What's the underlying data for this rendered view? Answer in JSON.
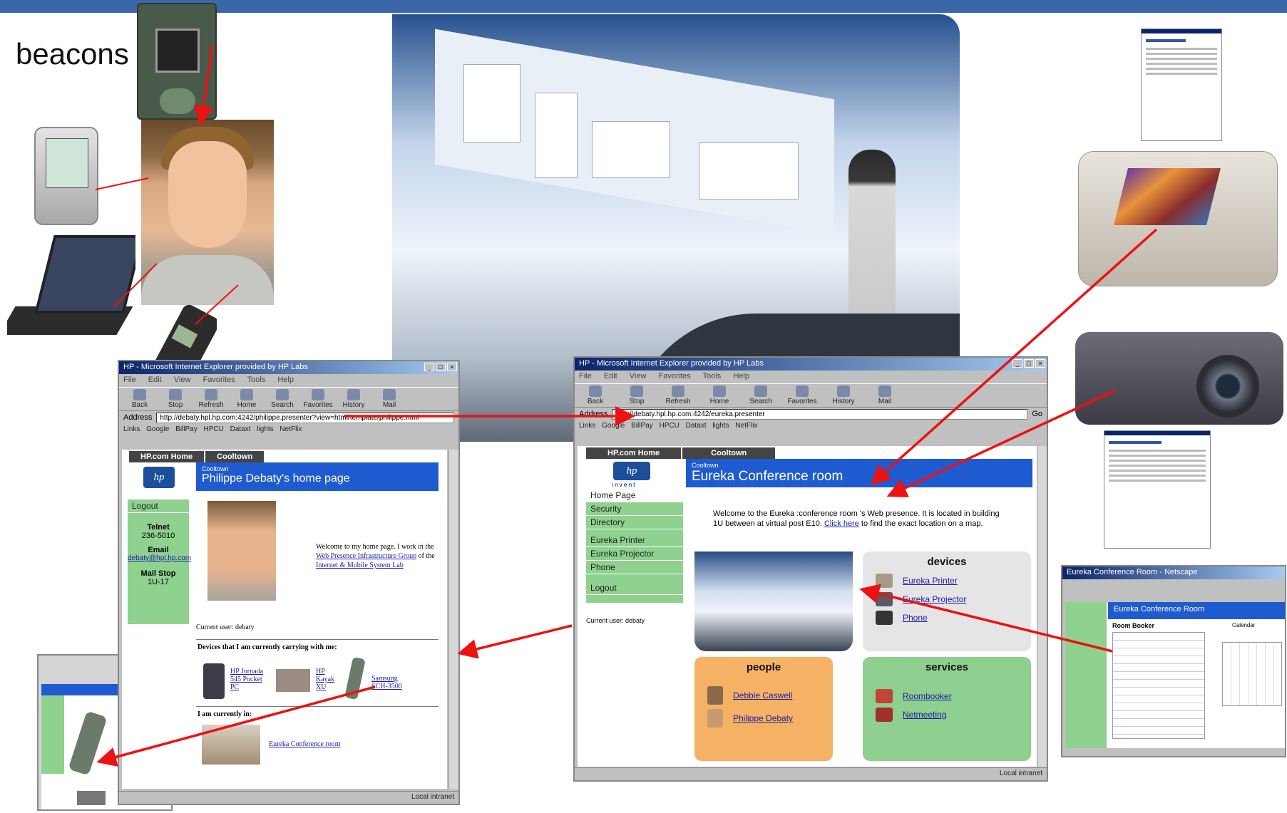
{
  "slide": {
    "caption": "beacons",
    "accent_color": "#3b67a8",
    "arrow_color": "#ee1111"
  },
  "left_window": {
    "title": "HP - Microsoft Internet Explorer provided by HP Labs",
    "menu": "File Edit View Favorites Tools Help",
    "toolbar": [
      "Back",
      "Stop",
      "Refresh",
      "Home",
      "Search",
      "Favorites",
      "History",
      "Mail"
    ],
    "address_label": "Address",
    "address": "http://debaty.hpl.hp.com:4242/philippe.presenter?view=html/template/philippe.html",
    "links": "Links  Google  BillPay  HPCU  Dataxt  lights  NetFlix",
    "tabs": [
      "HP.com Home",
      "Cooltown"
    ],
    "site_label": "Cooltown",
    "page_title": "Philippe Debaty's home page",
    "sidebar": {
      "logout": "Logout",
      "telnet_label": "Telnet",
      "telnet_value": "236-5010",
      "email_label": "Email",
      "email_value": "debaty@hpl.hp.com",
      "mailstop_label": "Mail Stop",
      "mailstop_value": "1U-17"
    },
    "welcome_prefix": "Welcome to my home page. I work in the",
    "welcome_link1": "Web Presence Infrastructure Group",
    "welcome_mid": "of the",
    "welcome_link2": "Internet & Mobile System Lab",
    "current_user": "Current user: debaty",
    "devices_heading": "Devices that I am currently carrying with me:",
    "devices": [
      "HP Jornada 545 Pocket PC",
      "HP Kayak XU",
      "Samsung SCH-3500"
    ],
    "i_am_heading": "I am currently in:",
    "location_link": "Eureka Conference room",
    "status": "Local intranet"
  },
  "right_window": {
    "title": "HP - Microsoft Internet Explorer provided by HP Labs",
    "menu": "File Edit View Favorites Tools Help",
    "toolbar": [
      "Back",
      "Stop",
      "Refresh",
      "Home",
      "Search",
      "Favorites",
      "History",
      "Mail"
    ],
    "address_label": "Address",
    "address": "http://debaty.hpl.hp.com:4242/eureka.presenter",
    "go": "Go",
    "links": "Links  Google  BillPay  HPCU  Dataxt  lights  NetFlix",
    "tabs": [
      "HP.com Home",
      "Cooltown"
    ],
    "logo_sub": "i n v e n t",
    "site_label": "Cooltown",
    "page_title": "Eureka Conference room",
    "sidebar": [
      "Home Page",
      "Security",
      "Directory",
      "Eureka Printer",
      "Eureka Projector",
      "Phone",
      "Logout"
    ],
    "current_user": "Current user: debaty",
    "welcome_text": "Welcome to the Eureka :conference room 's Web presence. It is located in building 1U between at virtual post E10.",
    "click_here": "Click here",
    "welcome_tail": "to find the exact location on a map.",
    "devices_header": "devices",
    "devices": [
      "Eureka Printer",
      "Eureka Projector",
      "Phone"
    ],
    "people_header": "people",
    "people": [
      "Debbie Caswell",
      "Philippe Debaty"
    ],
    "services_header": "services",
    "services": [
      "Roombooker",
      "Netmeeting"
    ],
    "status": "Local intranet",
    "colors": {
      "devices": "#e5e5e5",
      "people": "#f5b264",
      "services": "#8fcf8f",
      "header_blue": "#1f5bd0"
    }
  },
  "small_window": {
    "title": "Eureka Conference Room - Netscape",
    "page_title": "Eureka Conference Room",
    "booker_title": "Room Booker",
    "calendar_label": "Calendar"
  }
}
